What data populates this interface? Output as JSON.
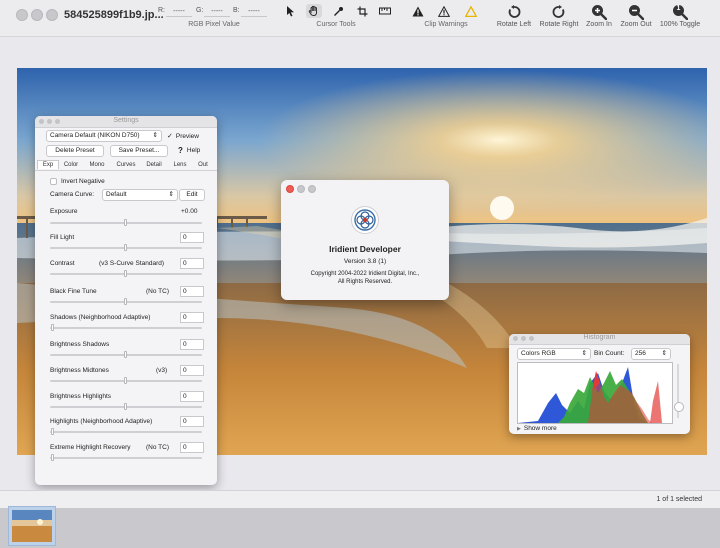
{
  "toolbar": {
    "document_title": "584525899f1b9.jp...",
    "rgb": {
      "r_label": "R:",
      "r_value": "-----",
      "g_label": "G:",
      "g_value": "-----",
      "b_label": "B:",
      "b_value": "-----",
      "caption": "RGB Pixel Value"
    },
    "cursor_tools_caption": "Cursor Tools",
    "clip_warnings_caption": "Clip Warnings",
    "buttons": [
      {
        "label": "Rotate Left",
        "icon": "rotate-left-icon"
      },
      {
        "label": "Rotate Right",
        "icon": "rotate-right-icon"
      },
      {
        "label": "Zoom In",
        "icon": "zoom-in-icon"
      },
      {
        "label": "Zoom Out",
        "icon": "zoom-out-icon"
      },
      {
        "label": "100% Toggle",
        "icon": "zoom-100-icon"
      }
    ],
    "zoom_100_glyph": "1"
  },
  "settings": {
    "title": "Settings",
    "preset": "Camera Default (NIKON D750)",
    "preview_label": "Preview",
    "preview_checked": true,
    "delete_preset": "Delete Preset",
    "save_preset": "Save Preset...",
    "help_label": "Help",
    "help_glyph": "?",
    "tabs": [
      "Exp",
      "Color",
      "Mono",
      "Curves",
      "Detail",
      "Lens",
      "Out"
    ],
    "active_tab": "Exp",
    "invert_negative": "Invert Negative",
    "camera_curve_label": "Camera Curve:",
    "camera_curve_value": "Default",
    "edit_button": "Edit",
    "exposure_label": "Exposure",
    "exposure_value": "+0.00",
    "fill_light": {
      "label": "Fill Light",
      "value": "0"
    },
    "contrast": {
      "label": "Contrast",
      "mode": "(v3 S-Curve Standard)",
      "value": "0"
    },
    "black_fine_tune": {
      "label": "Black Fine Tune",
      "mode": "(No TC)",
      "value": "0"
    },
    "shadows": {
      "label": "Shadows (Neighborhood Adaptive)",
      "value": "0"
    },
    "brightness_shadows": {
      "label": "Brightness Shadows",
      "value": "0"
    },
    "brightness_midtones": {
      "label": "Brightness Midtones",
      "mode": "(v3)",
      "value": "0"
    },
    "brightness_highlights": {
      "label": "Brightness Highlights",
      "value": "0"
    },
    "highlights": {
      "label": "Highlights (Neighborhood Adaptive)",
      "value": "0"
    },
    "extreme_highlight": {
      "label": "Extreme Highlight Recovery",
      "mode": "(No TC)",
      "value": "0"
    }
  },
  "about": {
    "app_name": "Iridient Developer",
    "version": "Version 3.8 (1)",
    "copyright_line1": "Copyright 2004-2022 Iridient Digital, Inc.,",
    "copyright_line2": "All Rights Reserved."
  },
  "histogram": {
    "title": "Histogram",
    "channel": "Colors RGB",
    "bin_count_label": "Bin Count:",
    "bin_count_value": "256",
    "show_more": "Show more"
  },
  "status": {
    "selection": "1 of 1 selected"
  },
  "colors": {
    "accent": "#0a63d6",
    "close_red": "#ee5d55",
    "clip_warning_yellow": "#e9b400",
    "hist_red": "#e23a36",
    "hist_green": "#3aa83a",
    "hist_blue": "#2f58d8"
  }
}
